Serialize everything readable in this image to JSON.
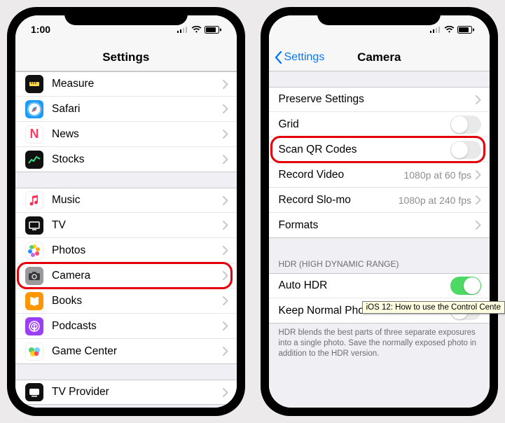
{
  "status": {
    "time": "1:00"
  },
  "left": {
    "title": "Settings",
    "group1": [
      {
        "name": "measure",
        "label": "Measure"
      },
      {
        "name": "safari",
        "label": "Safari"
      },
      {
        "name": "news",
        "label": "News"
      },
      {
        "name": "stocks",
        "label": "Stocks"
      }
    ],
    "group2": [
      {
        "name": "music",
        "label": "Music"
      },
      {
        "name": "tv",
        "label": "TV"
      },
      {
        "name": "photos",
        "label": "Photos"
      },
      {
        "name": "camera",
        "label": "Camera",
        "highlight": true
      },
      {
        "name": "books",
        "label": "Books"
      },
      {
        "name": "podcasts",
        "label": "Podcasts"
      },
      {
        "name": "gamectr",
        "label": "Game Center"
      }
    ],
    "group3": [
      {
        "name": "tvprov",
        "label": "TV Provider"
      }
    ]
  },
  "right": {
    "back": "Settings",
    "title": "Camera",
    "group1": [
      {
        "type": "chevron",
        "label": "Preserve Settings"
      },
      {
        "type": "toggle",
        "label": "Grid",
        "on": false
      },
      {
        "type": "toggle",
        "label": "Scan QR Codes",
        "on": false,
        "highlight": true
      },
      {
        "type": "chevron",
        "label": "Record Video",
        "detail": "1080p at 60 fps"
      },
      {
        "type": "chevron",
        "label": "Record Slo-mo",
        "detail": "1080p at 240 fps"
      },
      {
        "type": "chevron",
        "label": "Formats"
      }
    ],
    "hdr_header": "HDR (HIGH DYNAMIC RANGE)",
    "group2": [
      {
        "type": "toggle",
        "label": "Auto HDR",
        "on": true
      },
      {
        "type": "toggle",
        "label": "Keep Normal Photo",
        "on": false
      }
    ],
    "hdr_footer": "HDR blends the best parts of three separate exposures into a single photo. Save the normally exposed photo in addition to the HDR version."
  },
  "tooltip": "iOS 12: How to use the Control Cente"
}
